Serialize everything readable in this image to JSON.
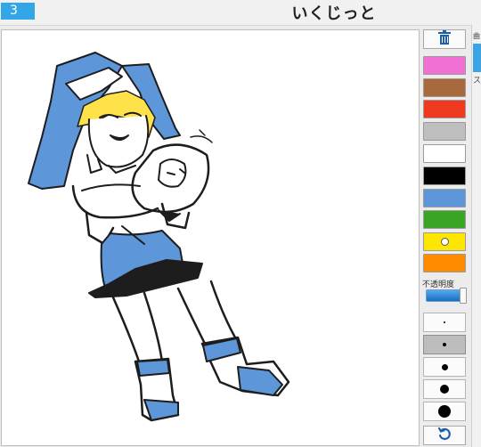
{
  "header": {
    "tab_number": "3",
    "title": "いくじっと"
  },
  "palette": {
    "colors": [
      "#f071d3",
      "#a86a3c",
      "#f03a20",
      "#bebebe",
      "#ffffff",
      "#000000",
      "#5e96da",
      "#3aa524",
      "#ffe600",
      "#ff8c00"
    ],
    "selected_color": "#ffe600",
    "opacity_label": "不透明度",
    "opacity_value": 1.0,
    "brush_sizes": [
      "tiny",
      "small",
      "medium",
      "large",
      "xlarge"
    ],
    "selected_brush": "small"
  },
  "sidebar": {
    "glyph": "曲",
    "char": "ス"
  },
  "icons": {
    "trash": "trash-icon",
    "undo": "undo-icon"
  }
}
